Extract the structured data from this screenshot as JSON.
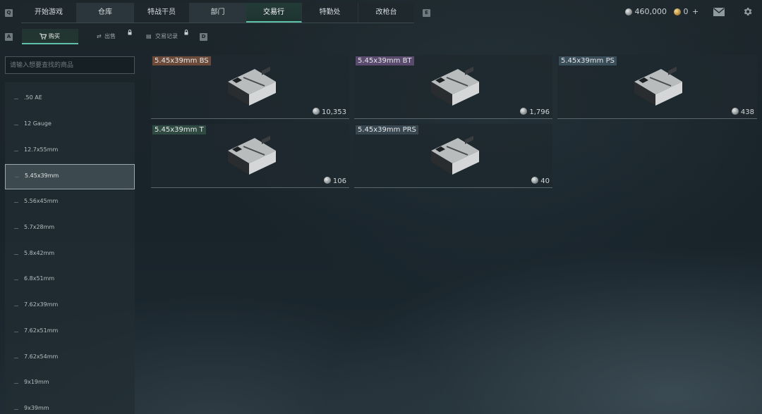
{
  "keys": {
    "nav_left": "Q",
    "nav_right": "E",
    "sub_left": "A",
    "sub_right": "D"
  },
  "nav": {
    "tabs": [
      {
        "label": "开始游戏"
      },
      {
        "label": "仓库"
      },
      {
        "label": "特战干员"
      },
      {
        "label": "部门"
      },
      {
        "label": "交易行",
        "active": true
      },
      {
        "label": "特勤处"
      },
      {
        "label": "改枪台"
      }
    ]
  },
  "currency": {
    "silver": "460,000",
    "gold": "0"
  },
  "icons": {
    "mail": "mail-icon",
    "settings": "gear-icon",
    "cart": "cart-icon",
    "lock": "lock-icon"
  },
  "subtabs": [
    {
      "label": "购买",
      "active": true
    },
    {
      "label": "出售",
      "locked": true
    },
    {
      "label": "交易记录",
      "locked": true
    }
  ],
  "search": {
    "placeholder": "请输入想要查找的商品",
    "value": ""
  },
  "categories": [
    {
      "label": ".50 AE"
    },
    {
      "label": "12 Gauge"
    },
    {
      "label": "12.7x55mm"
    },
    {
      "label": "5.45x39mm",
      "selected": true
    },
    {
      "label": "5.56x45mm"
    },
    {
      "label": "5.7x28mm"
    },
    {
      "label": "5.8x42mm"
    },
    {
      "label": "6.8x51mm"
    },
    {
      "label": "7.62x39mm"
    },
    {
      "label": "7.62x51mm"
    },
    {
      "label": "7.62x54mm"
    },
    {
      "label": "9x19mm"
    },
    {
      "label": "9x39mm"
    }
  ],
  "items": [
    {
      "name": "5.45x39mm BS",
      "price": "10,353",
      "tag_color": "#6b4a3a"
    },
    {
      "name": "5.45x39mm BT",
      "price": "1,796",
      "tag_color": "#5a4a6e"
    },
    {
      "name": "5.45x39mm PS",
      "price": "438",
      "tag_color": "#3a4e5a"
    },
    {
      "name": "5.45x39mm T",
      "price": "106",
      "tag_color": "#2f4a40"
    },
    {
      "name": "5.45x39mm PRS",
      "price": "40",
      "tag_color": "#384650"
    }
  ]
}
